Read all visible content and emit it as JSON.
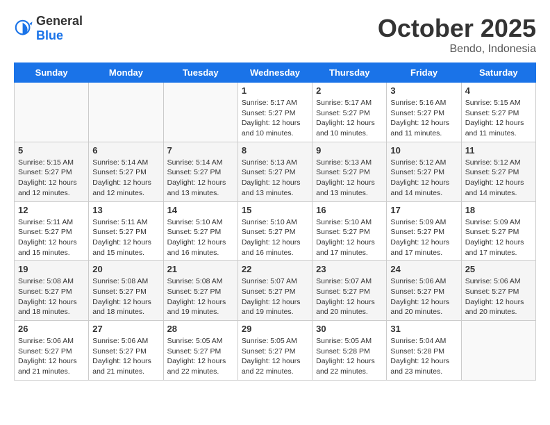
{
  "header": {
    "logo_general": "General",
    "logo_blue": "Blue",
    "month_title": "October 2025",
    "location": "Bendo, Indonesia"
  },
  "days_of_week": [
    "Sunday",
    "Monday",
    "Tuesday",
    "Wednesday",
    "Thursday",
    "Friday",
    "Saturday"
  ],
  "weeks": [
    {
      "shaded": false,
      "days": [
        {
          "number": "",
          "info": ""
        },
        {
          "number": "",
          "info": ""
        },
        {
          "number": "",
          "info": ""
        },
        {
          "number": "1",
          "info": "Sunrise: 5:17 AM\nSunset: 5:27 PM\nDaylight: 12 hours\nand 10 minutes."
        },
        {
          "number": "2",
          "info": "Sunrise: 5:17 AM\nSunset: 5:27 PM\nDaylight: 12 hours\nand 10 minutes."
        },
        {
          "number": "3",
          "info": "Sunrise: 5:16 AM\nSunset: 5:27 PM\nDaylight: 12 hours\nand 11 minutes."
        },
        {
          "number": "4",
          "info": "Sunrise: 5:15 AM\nSunset: 5:27 PM\nDaylight: 12 hours\nand 11 minutes."
        }
      ]
    },
    {
      "shaded": true,
      "days": [
        {
          "number": "5",
          "info": "Sunrise: 5:15 AM\nSunset: 5:27 PM\nDaylight: 12 hours\nand 12 minutes."
        },
        {
          "number": "6",
          "info": "Sunrise: 5:14 AM\nSunset: 5:27 PM\nDaylight: 12 hours\nand 12 minutes."
        },
        {
          "number": "7",
          "info": "Sunrise: 5:14 AM\nSunset: 5:27 PM\nDaylight: 12 hours\nand 13 minutes."
        },
        {
          "number": "8",
          "info": "Sunrise: 5:13 AM\nSunset: 5:27 PM\nDaylight: 12 hours\nand 13 minutes."
        },
        {
          "number": "9",
          "info": "Sunrise: 5:13 AM\nSunset: 5:27 PM\nDaylight: 12 hours\nand 13 minutes."
        },
        {
          "number": "10",
          "info": "Sunrise: 5:12 AM\nSunset: 5:27 PM\nDaylight: 12 hours\nand 14 minutes."
        },
        {
          "number": "11",
          "info": "Sunrise: 5:12 AM\nSunset: 5:27 PM\nDaylight: 12 hours\nand 14 minutes."
        }
      ]
    },
    {
      "shaded": false,
      "days": [
        {
          "number": "12",
          "info": "Sunrise: 5:11 AM\nSunset: 5:27 PM\nDaylight: 12 hours\nand 15 minutes."
        },
        {
          "number": "13",
          "info": "Sunrise: 5:11 AM\nSunset: 5:27 PM\nDaylight: 12 hours\nand 15 minutes."
        },
        {
          "number": "14",
          "info": "Sunrise: 5:10 AM\nSunset: 5:27 PM\nDaylight: 12 hours\nand 16 minutes."
        },
        {
          "number": "15",
          "info": "Sunrise: 5:10 AM\nSunset: 5:27 PM\nDaylight: 12 hours\nand 16 minutes."
        },
        {
          "number": "16",
          "info": "Sunrise: 5:10 AM\nSunset: 5:27 PM\nDaylight: 12 hours\nand 17 minutes."
        },
        {
          "number": "17",
          "info": "Sunrise: 5:09 AM\nSunset: 5:27 PM\nDaylight: 12 hours\nand 17 minutes."
        },
        {
          "number": "18",
          "info": "Sunrise: 5:09 AM\nSunset: 5:27 PM\nDaylight: 12 hours\nand 17 minutes."
        }
      ]
    },
    {
      "shaded": true,
      "days": [
        {
          "number": "19",
          "info": "Sunrise: 5:08 AM\nSunset: 5:27 PM\nDaylight: 12 hours\nand 18 minutes."
        },
        {
          "number": "20",
          "info": "Sunrise: 5:08 AM\nSunset: 5:27 PM\nDaylight: 12 hours\nand 18 minutes."
        },
        {
          "number": "21",
          "info": "Sunrise: 5:08 AM\nSunset: 5:27 PM\nDaylight: 12 hours\nand 19 minutes."
        },
        {
          "number": "22",
          "info": "Sunrise: 5:07 AM\nSunset: 5:27 PM\nDaylight: 12 hours\nand 19 minutes."
        },
        {
          "number": "23",
          "info": "Sunrise: 5:07 AM\nSunset: 5:27 PM\nDaylight: 12 hours\nand 20 minutes."
        },
        {
          "number": "24",
          "info": "Sunrise: 5:06 AM\nSunset: 5:27 PM\nDaylight: 12 hours\nand 20 minutes."
        },
        {
          "number": "25",
          "info": "Sunrise: 5:06 AM\nSunset: 5:27 PM\nDaylight: 12 hours\nand 20 minutes."
        }
      ]
    },
    {
      "shaded": false,
      "days": [
        {
          "number": "26",
          "info": "Sunrise: 5:06 AM\nSunset: 5:27 PM\nDaylight: 12 hours\nand 21 minutes."
        },
        {
          "number": "27",
          "info": "Sunrise: 5:06 AM\nSunset: 5:27 PM\nDaylight: 12 hours\nand 21 minutes."
        },
        {
          "number": "28",
          "info": "Sunrise: 5:05 AM\nSunset: 5:27 PM\nDaylight: 12 hours\nand 22 minutes."
        },
        {
          "number": "29",
          "info": "Sunrise: 5:05 AM\nSunset: 5:27 PM\nDaylight: 12 hours\nand 22 minutes."
        },
        {
          "number": "30",
          "info": "Sunrise: 5:05 AM\nSunset: 5:28 PM\nDaylight: 12 hours\nand 22 minutes."
        },
        {
          "number": "31",
          "info": "Sunrise: 5:04 AM\nSunset: 5:28 PM\nDaylight: 12 hours\nand 23 minutes."
        },
        {
          "number": "",
          "info": ""
        }
      ]
    }
  ]
}
